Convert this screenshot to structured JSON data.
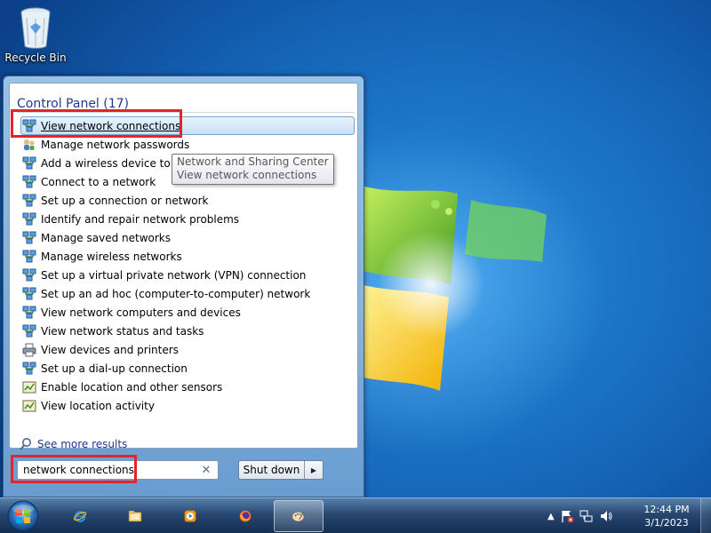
{
  "desktop": {
    "icons": [
      {
        "label": "Recycle Bin",
        "icon": "recycle-bin-icon"
      }
    ]
  },
  "start_menu": {
    "group_title": "Control Panel (17)",
    "results": [
      {
        "label": "View network connections",
        "icon": "network-icon",
        "selected": true
      },
      {
        "label": "Manage network passwords",
        "icon": "users-key-icon"
      },
      {
        "label": "Add a wireless device to t",
        "icon": "network-icon"
      },
      {
        "label": "Connect to a network",
        "icon": "network-icon"
      },
      {
        "label": "Set up a connection or network",
        "icon": "network-icon"
      },
      {
        "label": "Identify and repair network problems",
        "icon": "network-icon"
      },
      {
        "label": "Manage saved networks",
        "icon": "network-icon"
      },
      {
        "label": "Manage wireless networks",
        "icon": "network-icon"
      },
      {
        "label": "Set up a virtual private network (VPN) connection",
        "icon": "network-icon"
      },
      {
        "label": "Set up an ad hoc (computer-to-computer) network",
        "icon": "network-icon"
      },
      {
        "label": "View network computers and devices",
        "icon": "network-icon"
      },
      {
        "label": "View network status and tasks",
        "icon": "network-icon"
      },
      {
        "label": "View devices and printers",
        "icon": "printer-icon"
      },
      {
        "label": "Set up a dial-up connection",
        "icon": "network-icon"
      },
      {
        "label": "Enable location and other sensors",
        "icon": "sensor-icon"
      },
      {
        "label": "View location activity",
        "icon": "sensor-icon"
      }
    ],
    "tooltip": {
      "line1": "Network and Sharing Center",
      "line2": "View network connections"
    },
    "see_more": "See more results",
    "search": {
      "value": "network connections"
    },
    "shutdown_label": "Shut down"
  },
  "taskbar": {
    "pinned": [
      {
        "name": "internet-explorer-icon"
      },
      {
        "name": "file-explorer-icon"
      },
      {
        "name": "media-player-icon"
      },
      {
        "name": "firefox-icon"
      },
      {
        "name": "paint-icon",
        "active": true
      }
    ],
    "clock": {
      "time": "12:44 PM",
      "date": "3/1/2023"
    }
  },
  "colors": {
    "highlight_box": "#e3242b",
    "group_title": "#1e3a8c",
    "desktop_blue": "#1d6fbf"
  }
}
